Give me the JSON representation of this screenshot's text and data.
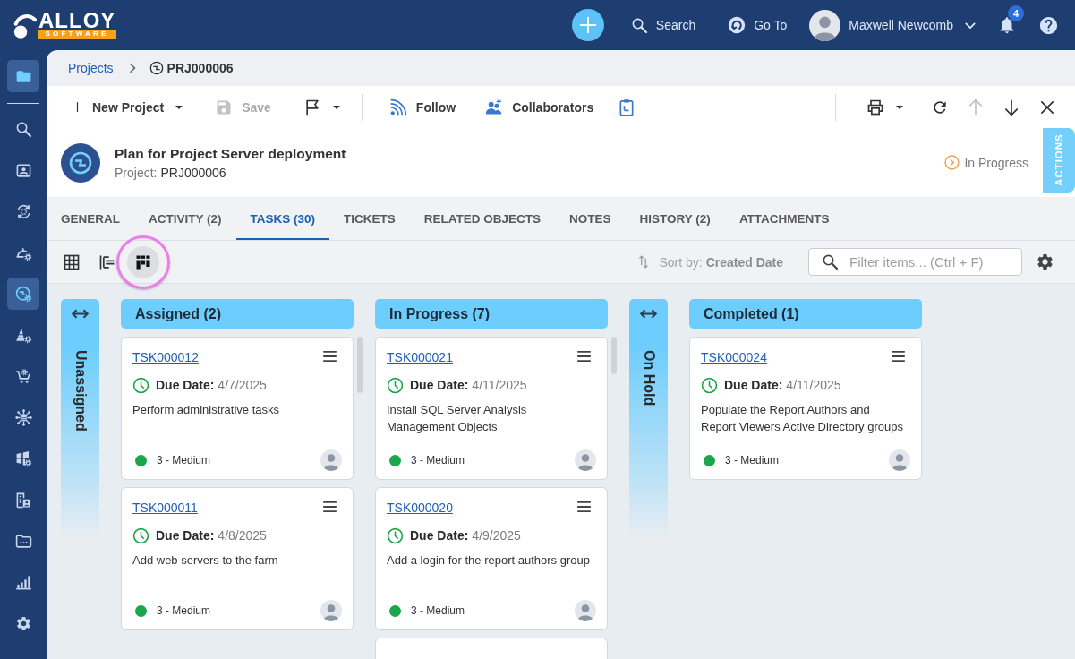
{
  "top_bar": {
    "logo": {
      "wordmark": "ALLOY",
      "tagline": "SOFTWARE"
    },
    "search_label": "Search",
    "goto_label": "Go To",
    "user": {
      "name": "Maxwell Newcomb"
    },
    "notifications": {
      "count": "4"
    }
  },
  "sidebar": {
    "items": [
      {
        "selected": true
      },
      {
        "selected": false
      },
      {
        "selected": false
      },
      {
        "selected": false
      },
      {
        "selected": false
      },
      {
        "selected": true
      },
      {
        "selected": false
      },
      {
        "selected": false
      },
      {
        "selected": false
      },
      {
        "selected": false
      },
      {
        "selected": false
      },
      {
        "selected": false
      },
      {
        "selected": false
      },
      {
        "selected": false
      }
    ]
  },
  "breadcrumb": [
    {
      "kind": "link",
      "label": "Projects"
    },
    {
      "kind": "current",
      "label": "PRJ000006"
    }
  ],
  "toolbar": {
    "new_button": {
      "label": "New Project"
    },
    "save_button": {
      "label": "Save",
      "disabled": true
    },
    "follow_button": {
      "label": "Follow"
    },
    "collaborators_button": {
      "label": "Collaborators"
    },
    "navigation": [
      {
        "kind": "up",
        "disabled": true
      },
      {
        "kind": "down",
        "disabled": false
      }
    ]
  },
  "record": {
    "title": "Plan for Project Server deployment",
    "type_label": "Project:",
    "number": "PRJ000006",
    "status": "In Progress",
    "actions_label": "ACTIONS"
  },
  "tabs": [
    {
      "label": "GENERAL",
      "selected": false
    },
    {
      "label": "ACTIVITY (2)",
      "selected": false
    },
    {
      "label": "TASKS (30)",
      "selected": true
    },
    {
      "label": "TICKETS",
      "selected": false
    },
    {
      "label": "RELATED OBJECTS",
      "selected": false
    },
    {
      "label": "NOTES",
      "selected": false
    },
    {
      "label": "HISTORY (2)",
      "selected": false
    },
    {
      "label": "ATTACHMENTS",
      "selected": false
    }
  ],
  "view_modes": [
    {
      "kind": "grid",
      "selected": false,
      "highlighted": false
    },
    {
      "kind": "list",
      "selected": false,
      "highlighted": false
    },
    {
      "kind": "board",
      "selected": true,
      "highlighted": true
    }
  ],
  "sort": {
    "text": "Sort by: **Created Date**"
  },
  "filter": {
    "placeholder": "Filter items... (Ctrl + F)"
  },
  "board": {
    "columns": [
      {
        "title": "Unassigned",
        "collapsed": true,
        "scrollable": false
      },
      {
        "title": "Assigned (2)",
        "collapsed": false,
        "scrollable": true,
        "cards": [
          {
            "cut_off": false,
            "id": "TSK000012",
            "due_label": "Due Date:",
            "due_date": "4/7/2025",
            "description": "Perform administrative tasks",
            "priority": "3 - Medium"
          },
          {
            "cut_off": false,
            "id": "TSK000011",
            "due_label": "Due Date:",
            "due_date": "4/8/2025",
            "description": "Add web servers to the farm",
            "priority": "3 - Medium"
          }
        ]
      },
      {
        "title": "In Progress (7)",
        "collapsed": false,
        "scrollable": true,
        "cards": [
          {
            "cut_off": false,
            "id": "TSK000021",
            "due_label": "Due Date:",
            "due_date": "4/11/2025",
            "description": "Install SQL Server Analysis Management Objects",
            "priority": "3 - Medium"
          },
          {
            "cut_off": false,
            "id": "TSK000020",
            "due_label": "Due Date:",
            "due_date": "4/9/2025",
            "description": "Add a login for the report authors group",
            "priority": "3 - Medium"
          },
          {
            "cut_off": true
          }
        ]
      },
      {
        "title": "On Hold",
        "collapsed": true,
        "scrollable": false
      },
      {
        "title": "Completed (1)",
        "collapsed": false,
        "scrollable": false,
        "cards": [
          {
            "cut_off": false,
            "id": "TSK000024",
            "due_label": "Due Date:",
            "due_date": "4/11/2025",
            "description": "Populate the Report Authors and Report Viewers Active Directory groups",
            "priority": "3 - Medium"
          }
        ]
      }
    ]
  }
}
